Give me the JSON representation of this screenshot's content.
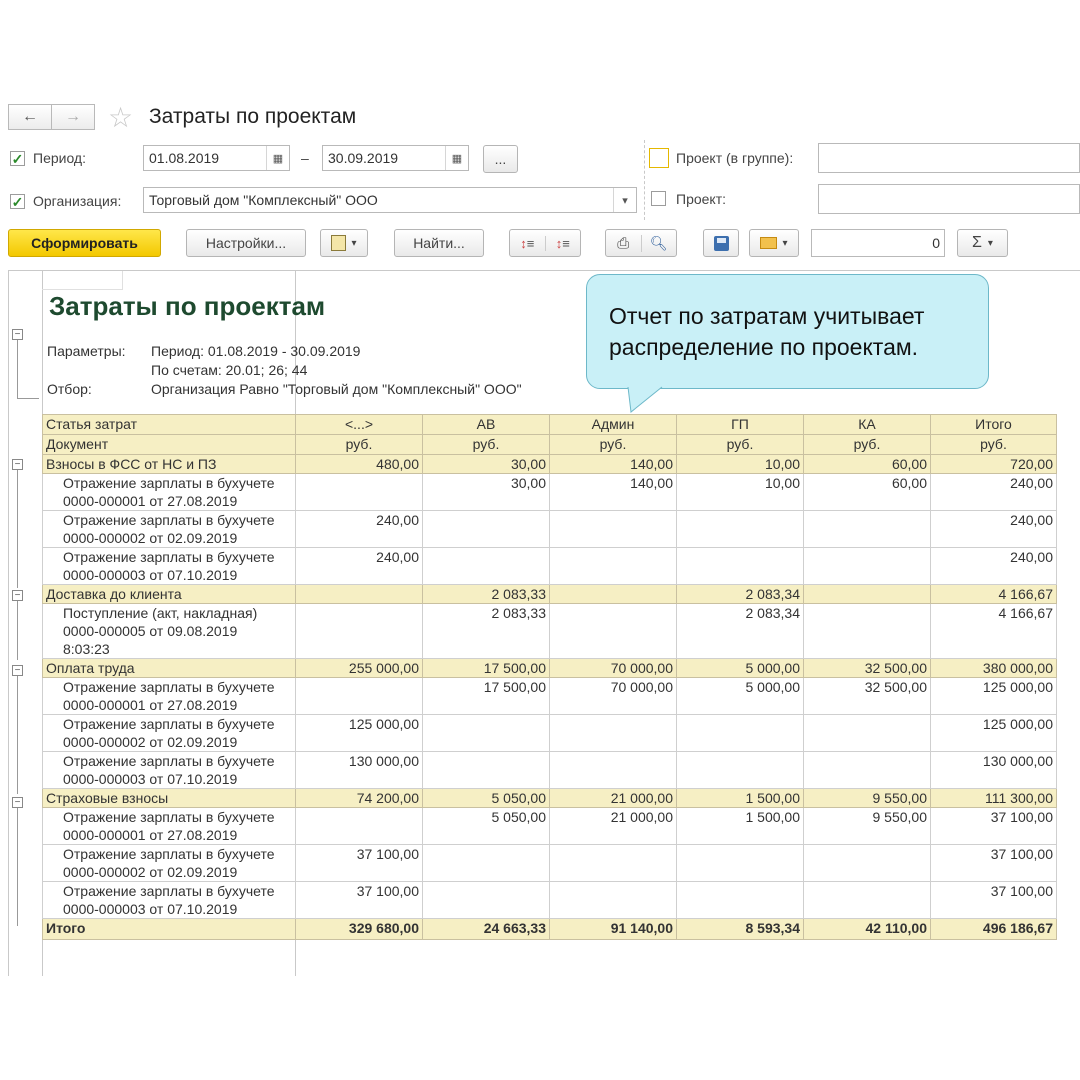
{
  "window": {
    "title": "Затраты по проектам"
  },
  "nav": {
    "back": "←",
    "forward": "→",
    "favorite": "☆"
  },
  "filters": {
    "period_label": "Период:",
    "period_from": "01.08.2019",
    "period_dash": "–",
    "period_to": "30.09.2019",
    "period_more": "...",
    "org_label": "Организация:",
    "org_value": "Торговый дом \"Комплексный\" ООО",
    "project_group_label": "Проект (в группе):",
    "project_label": "Проект:"
  },
  "toolbar": {
    "generate": "Сформировать",
    "settings": "Настройки...",
    "find": "Найти...",
    "sum_value": "0",
    "sigma": "Σ"
  },
  "report": {
    "title": "Затраты по проектам",
    "params_label": "Параметры:",
    "params_period": "Период: 01.08.2019 - 30.09.2019",
    "params_accounts": "По счетам: 20.01; 26; 44",
    "filter_label": "Отбор:",
    "filter_value": "Организация Равно \"Торговый дом \"Комплексный\" ООО\"",
    "header": {
      "col1a": "Статья затрат",
      "col1b": "Документ",
      "projects": [
        "<...>",
        "АВ",
        "Админ",
        "ГП",
        "КА",
        "Итого"
      ],
      "unit": "руб."
    },
    "groups": [
      {
        "name": "Взносы в ФСС от НС и ПЗ",
        "values": [
          "480,00",
          "30,00",
          "140,00",
          "10,00",
          "60,00",
          "720,00"
        ],
        "rows": [
          {
            "doc1": "Отражение зарплаты в бухучете",
            "doc2": "0000-000001 от 27.08.2019",
            "values": [
              "",
              "30,00",
              "140,00",
              "10,00",
              "60,00",
              "240,00"
            ]
          },
          {
            "doc1": "Отражение зарплаты в бухучете",
            "doc2": "0000-000002 от 02.09.2019",
            "values": [
              "240,00",
              "",
              "",
              "",
              "",
              "240,00"
            ]
          },
          {
            "doc1": "Отражение зарплаты в бухучете",
            "doc2": "0000-000003 от 07.10.2019",
            "values": [
              "240,00",
              "",
              "",
              "",
              "",
              "240,00"
            ]
          }
        ]
      },
      {
        "name": "Доставка до клиента",
        "values": [
          "",
          "2 083,33",
          "",
          "2 083,34",
          "",
          "4 166,67"
        ],
        "rows": [
          {
            "doc1": "Поступление (акт, накладная)",
            "doc2": "0000-000005 от 09.08.2019",
            "doc3": "8:03:23",
            "values": [
              "",
              "2 083,33",
              "",
              "2 083,34",
              "",
              "4 166,67"
            ]
          }
        ]
      },
      {
        "name": "Оплата труда",
        "values": [
          "255 000,00",
          "17 500,00",
          "70 000,00",
          "5 000,00",
          "32 500,00",
          "380 000,00"
        ],
        "rows": [
          {
            "doc1": "Отражение зарплаты в бухучете",
            "doc2": "0000-000001 от 27.08.2019",
            "values": [
              "",
              "17 500,00",
              "70 000,00",
              "5 000,00",
              "32 500,00",
              "125 000,00"
            ]
          },
          {
            "doc1": "Отражение зарплаты в бухучете",
            "doc2": "0000-000002 от 02.09.2019",
            "values": [
              "125 000,00",
              "",
              "",
              "",
              "",
              "125 000,00"
            ]
          },
          {
            "doc1": "Отражение зарплаты в бухучете",
            "doc2": "0000-000003 от 07.10.2019",
            "values": [
              "130 000,00",
              "",
              "",
              "",
              "",
              "130 000,00"
            ]
          }
        ]
      },
      {
        "name": "Страховые взносы",
        "values": [
          "74 200,00",
          "5 050,00",
          "21 000,00",
          "1 500,00",
          "9 550,00",
          "111 300,00"
        ],
        "rows": [
          {
            "doc1": "Отражение зарплаты в бухучете",
            "doc2": "0000-000001 от 27.08.2019",
            "values": [
              "",
              "5 050,00",
              "21 000,00",
              "1 500,00",
              "9 550,00",
              "37 100,00"
            ]
          },
          {
            "doc1": "Отражение зарплаты в бухучете",
            "doc2": "0000-000002 от 02.09.2019",
            "values": [
              "37 100,00",
              "",
              "",
              "",
              "",
              "37 100,00"
            ]
          },
          {
            "doc1": "Отражение зарплаты в бухучете",
            "doc2": "0000-000003 от 07.10.2019",
            "values": [
              "37 100,00",
              "",
              "",
              "",
              "",
              "37 100,00"
            ]
          }
        ]
      }
    ],
    "total": {
      "label": "Итого",
      "values": [
        "329 680,00",
        "24 663,33",
        "91 140,00",
        "8 593,34",
        "42 110,00",
        "496 186,67"
      ]
    }
  },
  "callout": {
    "line1": "Отчет по затратам учитывает",
    "line2": "распределение по проектам."
  },
  "colors": {
    "accent_yellow": "#f3c800",
    "header_bg": "#f6efc4",
    "title_green": "#1e4a2f",
    "callout_bg": "#c9f0f7",
    "check_green": "#2a8a2a"
  }
}
